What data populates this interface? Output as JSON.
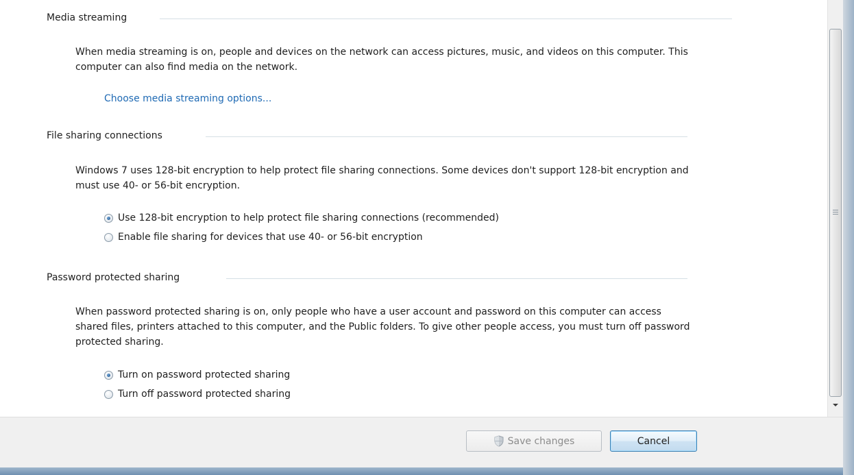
{
  "sections": {
    "media": {
      "title": "Media streaming",
      "description": "When media streaming is on, people and devices on the network can access pictures, music, and videos on this computer. This computer can also find media on the network.",
      "link": "Choose media streaming options..."
    },
    "file_sharing": {
      "title": "File sharing connections",
      "description": "Windows 7 uses 128-bit encryption to help protect file sharing connections. Some devices don't support 128-bit encryption and must use 40- or 56-bit encryption.",
      "options": [
        {
          "label": "Use 128-bit encryption to help protect file sharing connections (recommended)",
          "selected": true
        },
        {
          "label": "Enable file sharing for devices that use 40- or 56-bit encryption",
          "selected": false
        }
      ]
    },
    "password": {
      "title": "Password protected sharing",
      "description": "When password protected sharing is on, only people who have a user account and password on this computer can access shared files, printers attached to this computer, and the Public folders. To give other people access, you must turn off password protected sharing.",
      "options": [
        {
          "label": "Turn on password protected sharing",
          "selected": true
        },
        {
          "label": "Turn off password protected sharing",
          "selected": false
        }
      ]
    }
  },
  "footer": {
    "save_label": "Save changes",
    "cancel_label": "Cancel"
  },
  "colors": {
    "link": "#1f6ab4",
    "accent_border": "#3c7fb1"
  },
  "icons": {
    "save_icon": "uac-shield-icon",
    "radio_selected": "radio-selected-icon",
    "radio_unselected": "radio-unselected-icon"
  }
}
